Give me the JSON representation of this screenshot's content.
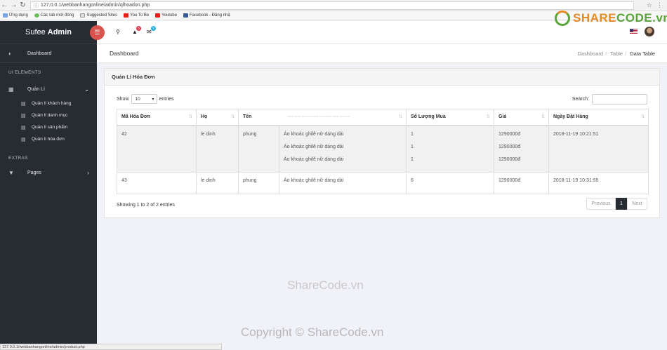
{
  "browser": {
    "url": "127.0.0.1/webbanhangonline/admin/qlhoadon.php",
    "bookmarks": [
      "Ứng dụng",
      "Các tab mới đóng",
      "Suggested Sites",
      "You To Be",
      "Youtube",
      "Facebook - Đăng nhậ"
    ],
    "status_url": "127.0.0.1/webbanhangonline/admin/product.php"
  },
  "sidebar": {
    "brand_1": "Sufee",
    "brand_2": "Admin",
    "dashboard": "Dashboard",
    "section_ui": "UI ELEMENTS",
    "quanli": "Quản Lí",
    "sub_items": [
      "Quản lí khách hàng",
      "Quản lí danh mục",
      "Quản lí sản phẩm",
      "Quản lí hóa đơn"
    ],
    "section_extras": "EXTRAS",
    "pages": "Pages"
  },
  "header": {
    "notif_count": "5",
    "msg_count": "9"
  },
  "page": {
    "title": "Dashboard",
    "breadcrumb": [
      "Dashboard",
      "Table",
      "Data Table"
    ]
  },
  "card": {
    "title": "Quản Lí Hóa Đơn",
    "show_label": "Show",
    "show_value": "10",
    "entries_label": "entries",
    "search_label": "Search:",
    "columns": [
      "Mã Hóa Đơn",
      "Họ",
      "Tên",
      "Số Lượng Mua",
      "Giá",
      "Ngày Đặt Hàng"
    ],
    "rows": [
      {
        "id": "42",
        "ho": "le dinh",
        "ten": "phung",
        "products": [
          "Áo khoác ghilê nữ dáng dài",
          "Áo khoác ghilê nữ dáng dài",
          "Áo khoác ghilê nữ dáng dài"
        ],
        "qty": [
          "1",
          "1",
          "1"
        ],
        "price": [
          "1290000đ",
          "1290000đ",
          "1290000đ"
        ],
        "date": "2018-11-19 10:21:51"
      },
      {
        "id": "43",
        "ho": "le dinh",
        "ten": "phung",
        "products": [
          "Áo khoác ghilê nữ dáng dài"
        ],
        "qty": [
          "6"
        ],
        "price": [
          "1290000đ"
        ],
        "date": "2018-11-19 10:31:55"
      }
    ],
    "footer_info": "Showing 1 to 2 of 2 entries",
    "pager": {
      "prev": "Previous",
      "current": "1",
      "next": "Next"
    }
  },
  "watermark": {
    "logo_a": "SHARE",
    "logo_b": "CODE.vn",
    "mid": "ShareCode.vn",
    "bottom": "Copyright © ShareCode.vn"
  }
}
